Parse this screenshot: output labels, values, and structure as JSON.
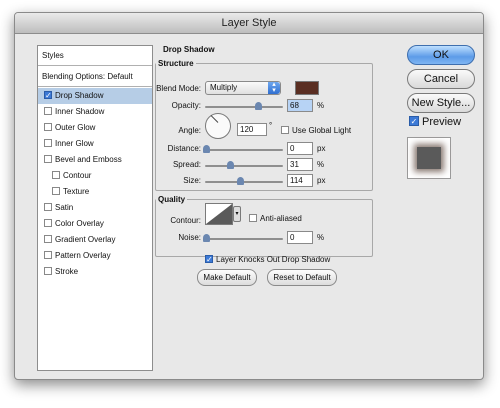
{
  "window": {
    "title": "Layer Style"
  },
  "styles_panel": {
    "header": "Styles",
    "blending_options": "Blending Options: Default",
    "items": [
      {
        "label": "Drop Shadow",
        "checked": true,
        "selected": true,
        "indent": false
      },
      {
        "label": "Inner Shadow",
        "checked": false,
        "selected": false,
        "indent": false
      },
      {
        "label": "Outer Glow",
        "checked": false,
        "selected": false,
        "indent": false
      },
      {
        "label": "Inner Glow",
        "checked": false,
        "selected": false,
        "indent": false
      },
      {
        "label": "Bevel and Emboss",
        "checked": false,
        "selected": false,
        "indent": false
      },
      {
        "label": "Contour",
        "checked": false,
        "selected": false,
        "indent": true
      },
      {
        "label": "Texture",
        "checked": false,
        "selected": false,
        "indent": true
      },
      {
        "label": "Satin",
        "checked": false,
        "selected": false,
        "indent": false
      },
      {
        "label": "Color Overlay",
        "checked": false,
        "selected": false,
        "indent": false
      },
      {
        "label": "Gradient Overlay",
        "checked": false,
        "selected": false,
        "indent": false
      },
      {
        "label": "Pattern Overlay",
        "checked": false,
        "selected": false,
        "indent": false
      },
      {
        "label": "Stroke",
        "checked": false,
        "selected": false,
        "indent": false
      }
    ]
  },
  "drop_shadow": {
    "title": "Drop Shadow",
    "structure": {
      "legend": "Structure",
      "blend_mode_label": "Blend Mode:",
      "blend_mode_value": "Multiply",
      "shadow_color": "#5a2e22",
      "opacity_label": "Opacity:",
      "opacity_value": "68",
      "opacity_unit": "%",
      "angle_label": "Angle:",
      "angle_value": "120",
      "angle_unit": "°",
      "global_light_label": "Use Global Light",
      "global_light_checked": false,
      "distance_label": "Distance:",
      "distance_value": "0",
      "distance_unit": "px",
      "spread_label": "Spread:",
      "spread_value": "31",
      "spread_unit": "%",
      "size_label": "Size:",
      "size_value": "114",
      "size_unit": "px"
    },
    "quality": {
      "legend": "Quality",
      "contour_label": "Contour:",
      "anti_aliased_label": "Anti-aliased",
      "anti_aliased_checked": false,
      "noise_label": "Noise:",
      "noise_value": "0",
      "noise_unit": "%"
    },
    "knocks_out_label": "Layer Knocks Out Drop Shadow",
    "knocks_out_checked": true,
    "make_default_label": "Make Default",
    "reset_default_label": "Reset to Default"
  },
  "buttons": {
    "ok": "OK",
    "cancel": "Cancel",
    "new_style": "New Style...",
    "preview_label": "Preview",
    "preview_checked": true
  },
  "colors": {
    "accent": "#3d7ad6",
    "selected_row": "#b6cde6"
  }
}
